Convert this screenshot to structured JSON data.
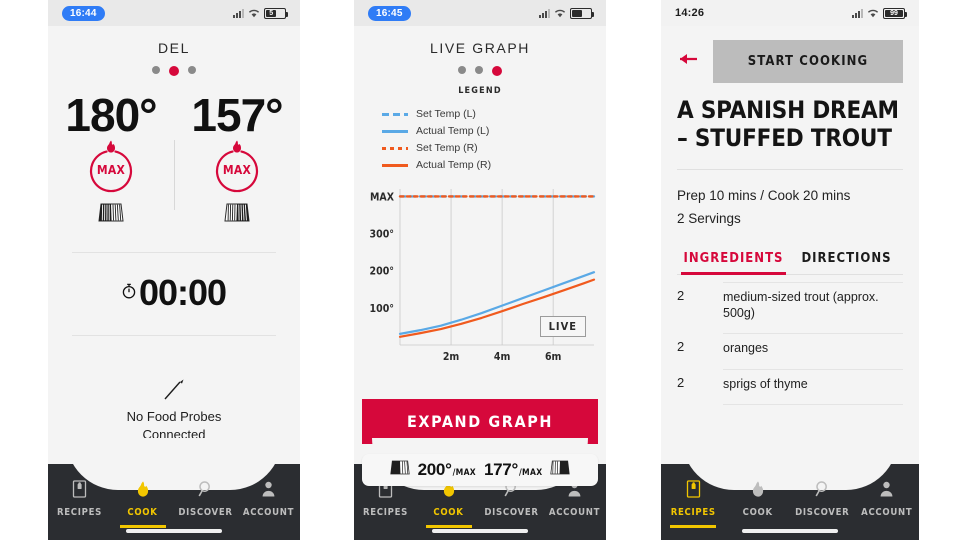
{
  "brand": {
    "accent_red": "#d6083b",
    "accent_yellow": "#f2c600",
    "line_blue": "#5aa9e6",
    "line_orange": "#f05a1e",
    "nav_dark": "#2b2d31"
  },
  "screen_cook": {
    "status": {
      "time": "16:44",
      "battery_text": "5"
    },
    "title": "DEL",
    "pager": {
      "count": 3,
      "active_index": 1
    },
    "zones": [
      {
        "temp": "180°",
        "dial_label": "MAX",
        "icon": "grill-zone-left-icon"
      },
      {
        "temp": "157°",
        "dial_label": "MAX",
        "icon": "grill-zone-right-icon"
      }
    ],
    "timer": {
      "icon": "stopwatch-icon",
      "value": "00:00"
    },
    "probes": {
      "icon": "food-probe-icon",
      "line1": "No Food Probes",
      "line2": "Connected"
    },
    "nav": {
      "items": [
        {
          "label": "RECIPES",
          "icon": "recipe-book-icon",
          "active": false
        },
        {
          "label": "COOK",
          "icon": "flame-icon",
          "active": true
        },
        {
          "label": "DISCOVER",
          "icon": "search-icon",
          "active": false
        },
        {
          "label": "ACCOUNT",
          "icon": "person-icon",
          "active": false
        }
      ]
    }
  },
  "screen_graph": {
    "status": {
      "time": "16:45",
      "battery_text": ""
    },
    "title": "LIVE GRAPH",
    "pager": {
      "count": 3,
      "active_index": 2
    },
    "legend_heading": "LEGEND",
    "legend": [
      {
        "label": "Set Temp (L)",
        "style": "dash-blue"
      },
      {
        "label": "Actual Temp (L)",
        "style": "solid-blue"
      },
      {
        "label": "Set Temp (R)",
        "style": "dot-orange"
      },
      {
        "label": "Actual Temp (R)",
        "style": "solid-orange"
      }
    ],
    "live_badge": "LIVE",
    "expand_label": "EXPAND GRAPH",
    "mini_status": [
      {
        "icon": "grill-zone-left-icon",
        "value": "200°",
        "suffix": "/MAX"
      },
      {
        "icon": "grill-zone-right-icon",
        "value": "177°",
        "suffix": "/MAX"
      }
    ],
    "nav": {
      "items": [
        {
          "label": "RECIPES",
          "icon": "recipe-book-icon",
          "active": false
        },
        {
          "label": "COOK",
          "icon": "flame-icon",
          "active": true
        },
        {
          "label": "DISCOVER",
          "icon": "search-icon",
          "active": false
        },
        {
          "label": "ACCOUNT",
          "icon": "person-icon",
          "active": false
        }
      ]
    }
  },
  "screen_recipe": {
    "status": {
      "time": "14:26",
      "battery_text": "99"
    },
    "back_icon": "back-arrow-icon",
    "start_label": "START COOKING",
    "title": "A SPANISH DREAM – STUFFED TROUT",
    "meta_line1": "Prep 10 mins / Cook 20 mins",
    "meta_line2": "2 Servings",
    "tabs": [
      {
        "label": "INGREDIENTS",
        "active": true
      },
      {
        "label": "DIRECTIONS",
        "active": false
      }
    ],
    "ingredients": [
      {
        "qty": "2",
        "name": "medium-sized trout (approx. 500g)"
      },
      {
        "qty": "2",
        "name": "oranges"
      },
      {
        "qty": "2",
        "name": "sprigs of thyme"
      }
    ],
    "nav": {
      "items": [
        {
          "label": "RECIPES",
          "icon": "recipe-book-icon",
          "active": true
        },
        {
          "label": "COOK",
          "icon": "flame-icon",
          "active": false
        },
        {
          "label": "DISCOVER",
          "icon": "search-icon",
          "active": false
        },
        {
          "label": "ACCOUNT",
          "icon": "person-icon",
          "active": false
        }
      ]
    }
  },
  "chart_data": {
    "type": "line",
    "title": "LIVE GRAPH",
    "xlabel": "",
    "ylabel": "",
    "grid": "vertical",
    "legend_position": "above",
    "x_tick_labels": [
      "2m",
      "4m",
      "6m"
    ],
    "x_ticks": [
      2,
      4,
      6
    ],
    "xlim": [
      0,
      7.6
    ],
    "y_tick_labels": [
      "100°",
      "200°",
      "300°",
      "MAX"
    ],
    "y_ticks": [
      100,
      200,
      300,
      400
    ],
    "ylim": [
      0,
      420
    ],
    "series": [
      {
        "name": "Set Temp (L)",
        "style": "dashed",
        "color": "#5aa9e6",
        "x": [
          0,
          7.6
        ],
        "values": [
          400,
          400
        ]
      },
      {
        "name": "Set Temp (R)",
        "style": "dotted",
        "color": "#f05a1e",
        "x": [
          0,
          7.6
        ],
        "values": [
          400,
          400
        ]
      },
      {
        "name": "Actual Temp (L)",
        "style": "solid",
        "color": "#5aa9e6",
        "x": [
          0,
          0.8,
          1.6,
          2.4,
          3.2,
          4.0,
          4.8,
          5.6,
          6.4,
          7.2,
          7.6
        ],
        "values": [
          30,
          40,
          52,
          68,
          86,
          106,
          126,
          146,
          166,
          186,
          196
        ]
      },
      {
        "name": "Actual Temp (R)",
        "style": "solid",
        "color": "#f05a1e",
        "x": [
          0,
          0.8,
          1.6,
          2.4,
          3.2,
          4.0,
          4.8,
          5.6,
          6.4,
          7.2,
          7.6
        ],
        "values": [
          22,
          32,
          43,
          57,
          73,
          91,
          110,
          128,
          147,
          166,
          176
        ]
      }
    ],
    "annotations": [
      {
        "text": "LIVE",
        "x": 6.6,
        "y": 70
      }
    ]
  }
}
